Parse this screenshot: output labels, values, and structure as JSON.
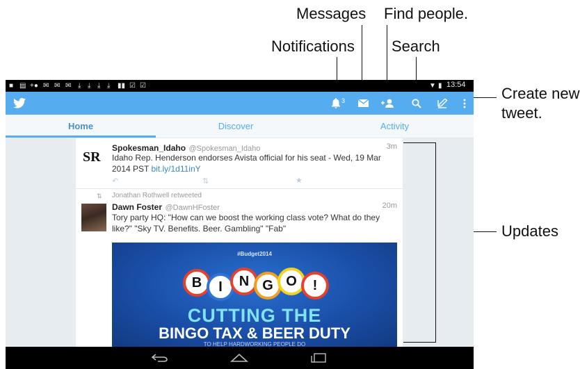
{
  "callouts": {
    "messages": "Messages",
    "find_people": "Find people.",
    "notifications": "Notifications",
    "search": "Search",
    "create_new_line1": "Create new",
    "create_new_line2": "tweet.",
    "updates": "Updates"
  },
  "status_bar": {
    "time": "13:54",
    "icons": [
      "chat-icon",
      "clipboard-icon",
      "add-user-icon",
      "mail-icon",
      "mail-icon",
      "mail-icon",
      "download-icon",
      "download-icon",
      "download-icon",
      "download-icon",
      "barcode-icon",
      "checkbox-icon",
      "checkbox-icon"
    ],
    "right_icons": [
      "wifi-icon",
      "battery-icon"
    ]
  },
  "app_bar": {
    "logo": "twitter-bird-icon",
    "notification_count": "3",
    "icons": [
      "notifications-icon",
      "messages-icon",
      "find-people-icon",
      "search-icon",
      "compose-icon",
      "overflow-menu-icon"
    ]
  },
  "tabs": [
    {
      "label": "Home",
      "active": true
    },
    {
      "label": "Discover",
      "active": false
    },
    {
      "label": "Activity",
      "active": false
    }
  ],
  "tweets": [
    {
      "logo_text": "SR",
      "name": "Spokesman_Idaho",
      "handle": "@Spokesman_Idaho",
      "time": "3m",
      "text_line1": "Idaho Rep. Henderson endorses Avista official for his seat - Wed, 19 Mar",
      "text_line2": "2014 PST ",
      "link": "bit.ly/1d11inY",
      "actions": [
        "reply-icon",
        "retweet-icon",
        "favorite-icon"
      ]
    },
    {
      "retweeted_by": "Jonathan Rothwell retweeted",
      "name": "Dawn Foster",
      "handle": "@DawnHFoster",
      "time": "20m",
      "text_line1": "Tory party HQ: \"How can we boost the working class vote? What do they",
      "text_line2": "like?\" \"Sky TV. Benefits. Beer. Gambling\" \"Fab\"",
      "image": {
        "tag": "#Budget2014",
        "balls": [
          "B",
          "I",
          "N",
          "G",
          "O",
          "!"
        ],
        "line1": "CUTTING THE",
        "line2": "BINGO TAX & BEER DUTY",
        "line3": "TO HELP HARDWORKING PEOPLE DO"
      }
    }
  ],
  "nav_bar": {
    "icons": [
      "back-icon",
      "home-icon",
      "recents-icon"
    ]
  },
  "colors": {
    "twitter_blue": "#55acee",
    "tab_bg": "#f5f8fa",
    "feed_bg": "#e6ecf0"
  }
}
